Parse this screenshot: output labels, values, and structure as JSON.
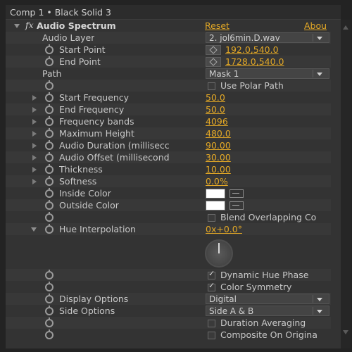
{
  "header": {
    "title": "Comp 1 • Black Solid 3"
  },
  "effect": {
    "fx_symbol": "fx",
    "name": "Audio Spectrum",
    "reset_label": "Reset",
    "about_label": "Abou"
  },
  "params": {
    "audio_layer": {
      "label": "Audio Layer",
      "value": "2. jol6min.D.wav"
    },
    "start_point": {
      "label": "Start Point",
      "value": "192.0,540.0"
    },
    "end_point": {
      "label": "End Point",
      "value": "1728.0,540.0"
    },
    "path": {
      "label": "Path",
      "value": "Mask 1"
    },
    "use_polar_path": {
      "label": "Use Polar Path",
      "checked": false
    },
    "start_frequency": {
      "label": "Start Frequency",
      "value": "50.0"
    },
    "end_frequency": {
      "label": "End Frequency",
      "value": "50.0"
    },
    "frequency_bands": {
      "label": "Frequency bands",
      "value": "4096"
    },
    "maximum_height": {
      "label": "Maximum Height",
      "value": "480.0"
    },
    "audio_duration": {
      "label": "Audio Duration (millisecc",
      "value": "90.00"
    },
    "audio_offset": {
      "label": "Audio Offset (millisecond",
      "value": "30.00"
    },
    "thickness": {
      "label": "Thickness",
      "value": "10.00"
    },
    "softness": {
      "label": "Softness",
      "value": "0.0%"
    },
    "inside_color": {
      "label": "Inside Color",
      "color": "#ffffff"
    },
    "outside_color": {
      "label": "Outside Color",
      "color": "#ffffff"
    },
    "blend_overlapping": {
      "label": "Blend Overlapping Co",
      "checked": false
    },
    "hue_interpolation": {
      "label": "Hue Interpolation",
      "value": "0x+0.0°"
    },
    "dynamic_hue_phase": {
      "label": "Dynamic Hue Phase",
      "checked": true
    },
    "color_symmetry": {
      "label": "Color Symmetry",
      "checked": true
    },
    "display_options": {
      "label": "Display Options",
      "value": "Digital"
    },
    "side_options": {
      "label": "Side Options",
      "value": "Side A & B"
    },
    "duration_averaging": {
      "label": "Duration Averaging",
      "checked": false
    },
    "composite_on_original": {
      "label": "Composite On Origina",
      "checked": false
    }
  },
  "colors": {
    "value_orange": "#e3a826",
    "panel_bg": "#333333",
    "swatch_white": "#ffffff"
  }
}
